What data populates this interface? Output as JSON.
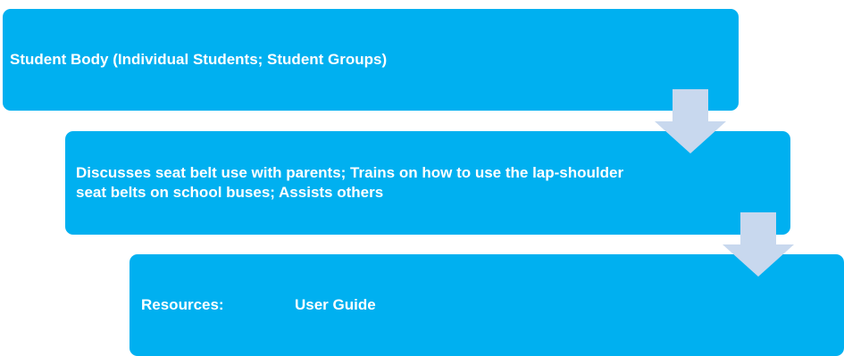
{
  "diagram": {
    "steps": [
      {
        "text": "Student Body (Individual Students; Student Groups)"
      },
      {
        "text": "Discusses seat belt use with parents; Trains on how to use the lap-shoulder seat belts on school buses; Assists others"
      },
      {
        "label": "Resources:",
        "value": "User Guide"
      }
    ],
    "colors": {
      "box": "#00b0f0",
      "arrow": "#c8d8ee",
      "text": "#ffffff"
    }
  }
}
